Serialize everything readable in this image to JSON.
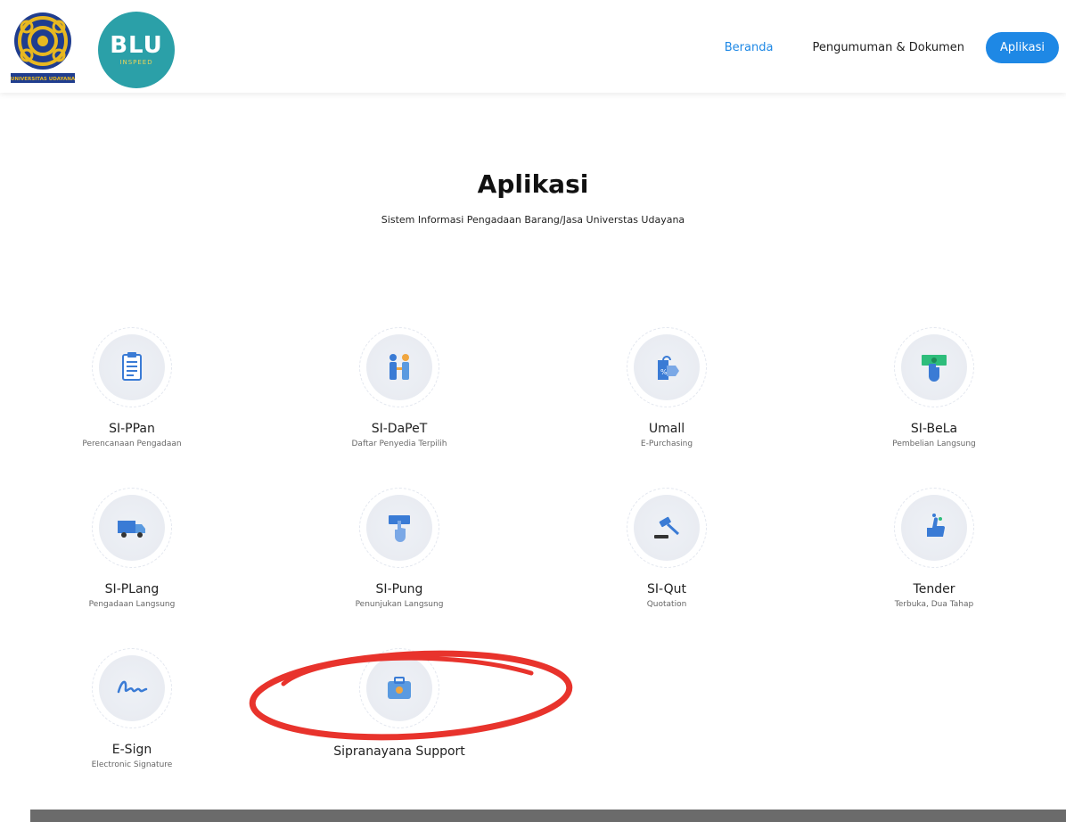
{
  "header": {
    "logo_unud_text": "UNIVERSITAS UDAYANA",
    "logo_blu_main": "BLU",
    "logo_blu_sub": "INSPEED",
    "nav": {
      "home": "Beranda",
      "docs": "Pengumuman & Dokumen",
      "apps": "Aplikasi"
    }
  },
  "page": {
    "title": "Aplikasi",
    "subtitle": "Sistem Informasi Pengadaan Barang/Jasa Universtas Udayana"
  },
  "apps": [
    {
      "name": "SI-PPan",
      "desc": "Perencanaan Pengadaan",
      "icon": "clipboard-icon"
    },
    {
      "name": "SI-DaPeT",
      "desc": "Daftar Penyedia Terpilih",
      "icon": "people-icon"
    },
    {
      "name": "Umall",
      "desc": "E-Purchasing",
      "icon": "shopping-tag-icon"
    },
    {
      "name": "SI-BeLa",
      "desc": "Pembelian Langsung",
      "icon": "money-hand-icon"
    },
    {
      "name": "SI-PLang",
      "desc": "Pengadaan Langsung",
      "icon": "truck-icon"
    },
    {
      "name": "SI-Pung",
      "desc": "Penunjukan Langsung",
      "icon": "pointing-hand-icon"
    },
    {
      "name": "SI-Qut",
      "desc": "Quotation",
      "icon": "gavel-icon"
    },
    {
      "name": "Tender",
      "desc": "Terbuka, Dua Tahap",
      "icon": "thumbs-up-icon"
    },
    {
      "name": "E-Sign",
      "desc": "Electronic Signature",
      "icon": "signature-icon"
    },
    {
      "name": "Sipranayana Support",
      "desc": "",
      "icon": "briefcase-icon"
    }
  ],
  "colors": {
    "accent": "#1e88e5",
    "highlight": "#e8332c",
    "icon_blue": "#3a7bd5"
  }
}
